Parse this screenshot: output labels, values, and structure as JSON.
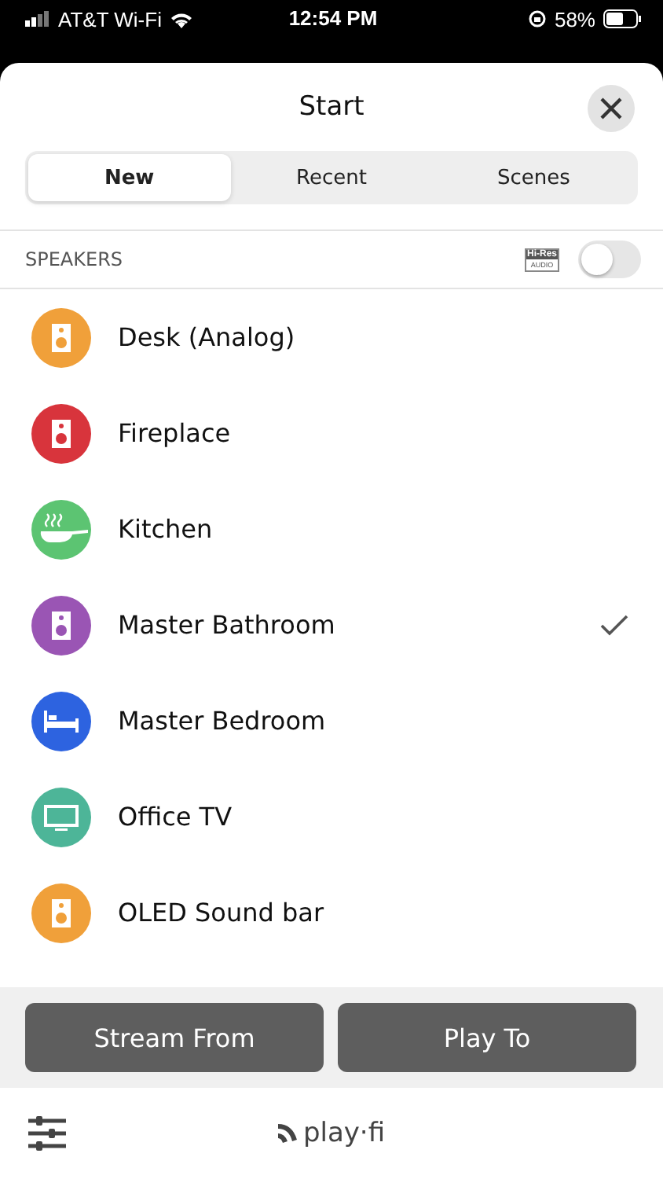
{
  "status_bar": {
    "carrier": "AT&T Wi-Fi",
    "time": "12:54 PM",
    "battery": "58%"
  },
  "title": "Start",
  "tabs": [
    {
      "label": "New",
      "selected": true
    },
    {
      "label": "Recent",
      "selected": false
    },
    {
      "label": "Scenes",
      "selected": false
    }
  ],
  "section": {
    "label": "SPEAKERS",
    "badge_top": "Hi-Res",
    "badge_bottom": "AUDIO",
    "hi_res_on": false
  },
  "speakers": [
    {
      "name": "Desk (Analog)",
      "kind": "speaker",
      "color": "#f0a03a",
      "selected": false
    },
    {
      "name": "Fireplace",
      "kind": "speaker",
      "color": "#d8343c",
      "selected": false
    },
    {
      "name": "Kitchen",
      "kind": "kitchen",
      "color": "#5cc472",
      "selected": false
    },
    {
      "name": "Master Bathroom",
      "kind": "speaker",
      "color": "#9a55b4",
      "selected": true
    },
    {
      "name": "Master Bedroom",
      "kind": "bed",
      "color": "#2d63e0",
      "selected": false
    },
    {
      "name": "Office TV",
      "kind": "tv",
      "color": "#4db598",
      "selected": false
    },
    {
      "name": "OLED Sound bar",
      "kind": "speaker",
      "color": "#f0a03a",
      "selected": false
    }
  ],
  "buttons": [
    "Stream From",
    "Play To"
  ],
  "logo": "play·fi"
}
